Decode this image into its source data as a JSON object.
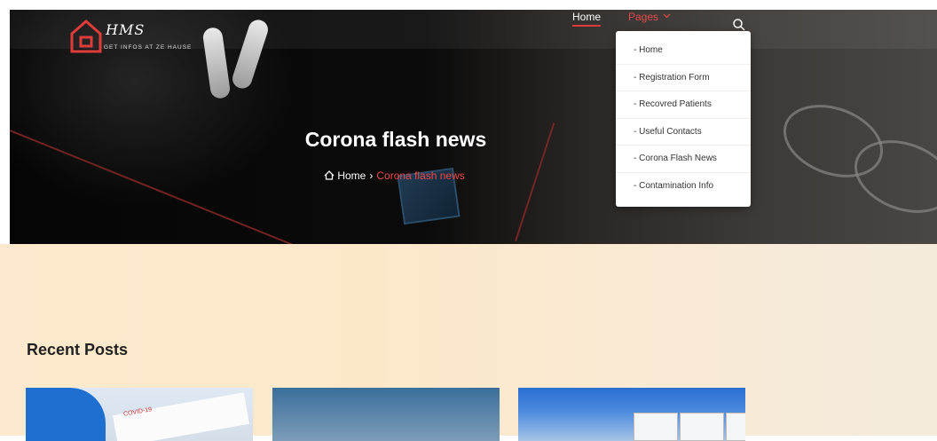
{
  "brand": {
    "title": "HMS",
    "tagline": "GET INFOS AT ZE HAUSE",
    "accent": "#e03b3b"
  },
  "nav": {
    "home": "Home",
    "pages": "Pages",
    "pages_icon": "chevron-down-icon",
    "search_icon": "search-icon"
  },
  "hero": {
    "title": "Corona flash news",
    "breadcrumb": {
      "home": "Home",
      "current": "Corona flash news"
    }
  },
  "dropdown": {
    "items": [
      "- Home",
      "- Registration Form",
      "- Recovred Patients",
      "- Useful Contacts",
      "- Corona Flash News",
      "- Contamination Info"
    ]
  },
  "main": {
    "section_title": "Recent Posts",
    "card1_label": "COVID-19"
  }
}
